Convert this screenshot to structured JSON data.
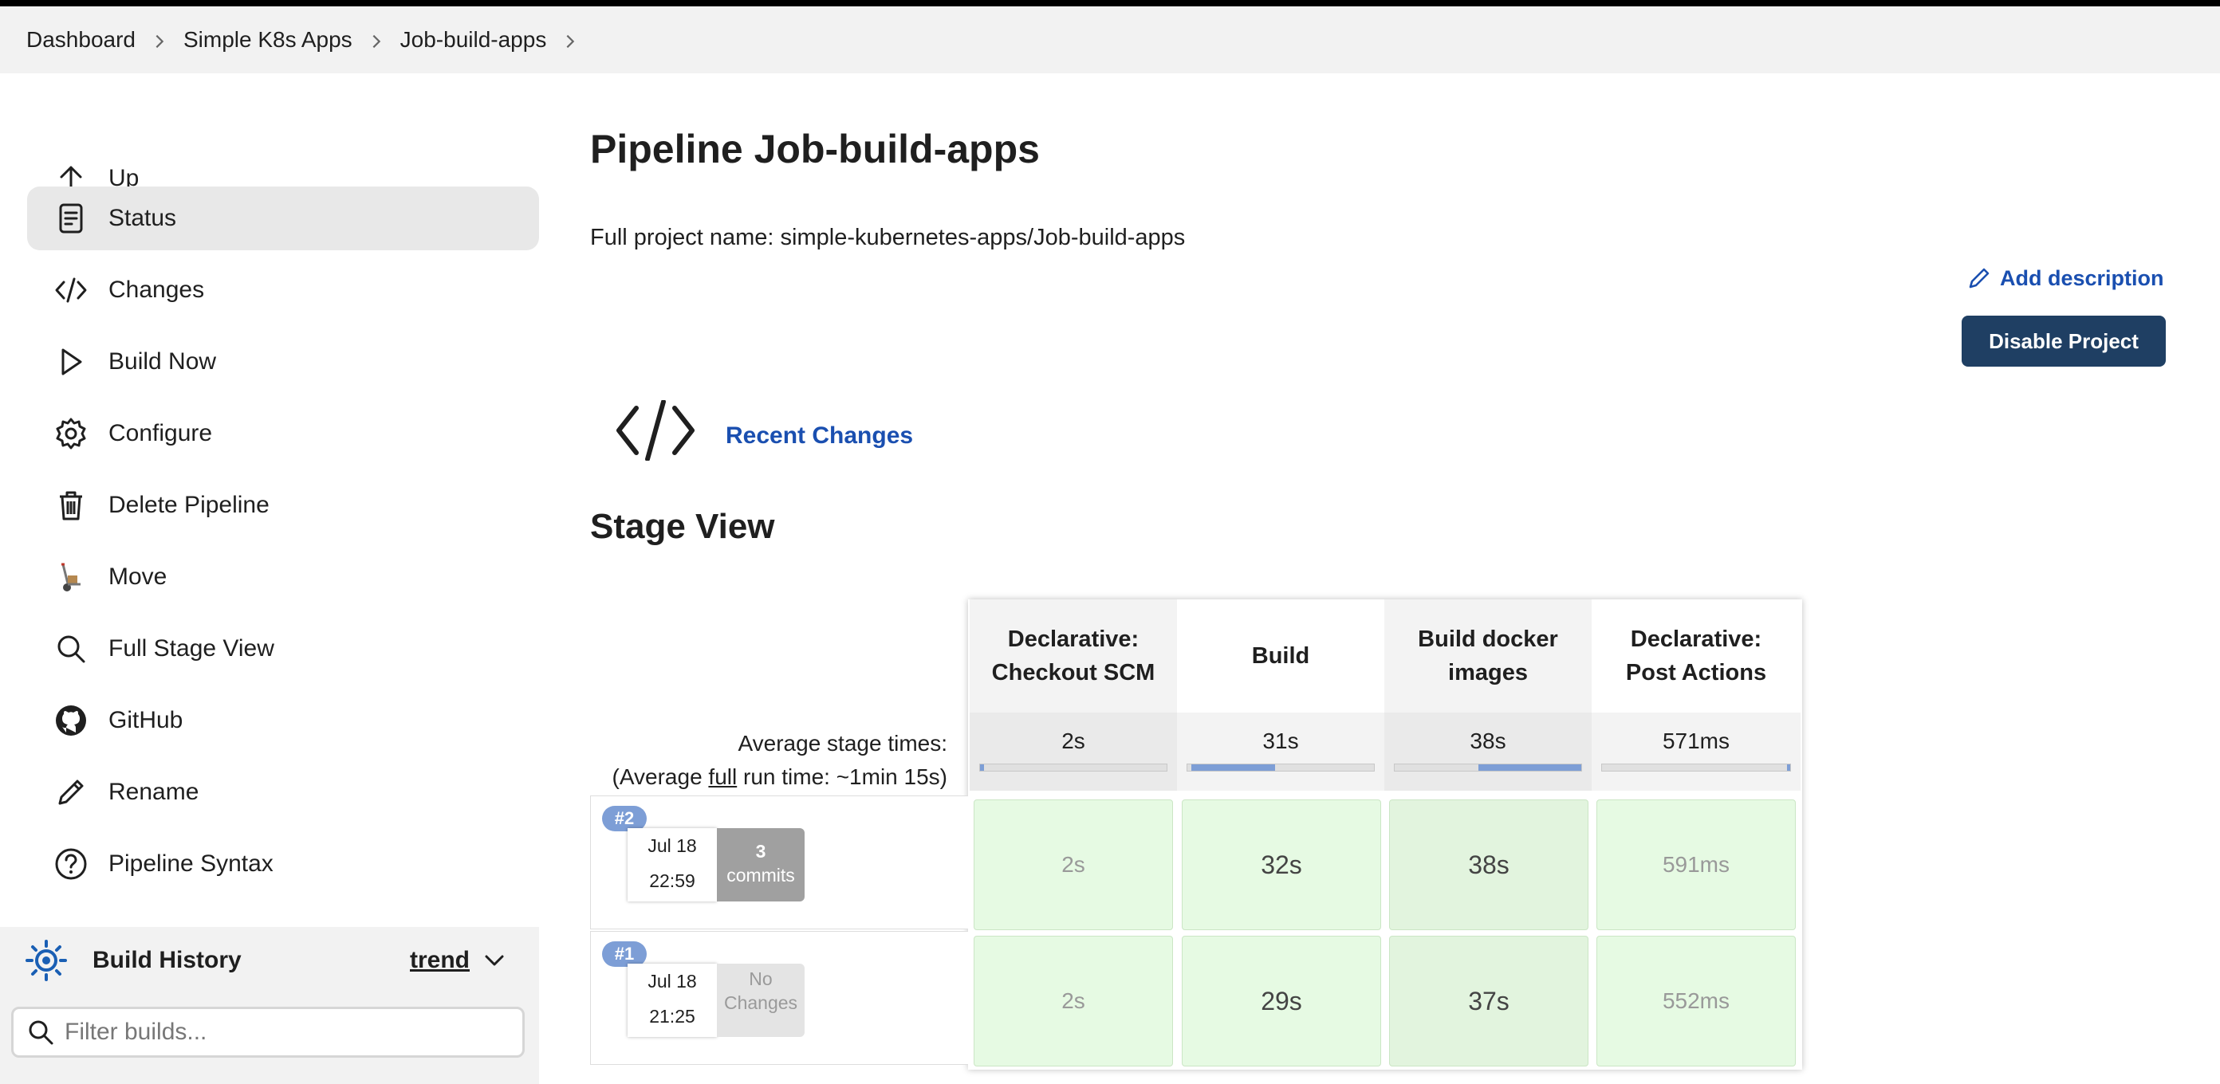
{
  "breadcrumb": [
    "Dashboard",
    "Simple K8s Apps",
    "Job-build-apps"
  ],
  "sidebar": {
    "items": [
      {
        "label": "Up",
        "icon": "arrow-up-icon"
      },
      {
        "label": "Status",
        "icon": "document-icon",
        "active": true
      },
      {
        "label": "Changes",
        "icon": "code-icon"
      },
      {
        "label": "Build Now",
        "icon": "play-icon"
      },
      {
        "label": "Configure",
        "icon": "gear-icon"
      },
      {
        "label": "Delete Pipeline",
        "icon": "trash-icon"
      },
      {
        "label": "Move",
        "icon": "hand-truck-icon"
      },
      {
        "label": "Full Stage View",
        "icon": "search-icon"
      },
      {
        "label": "GitHub",
        "icon": "github-icon"
      },
      {
        "label": "Rename",
        "icon": "pencil-icon"
      },
      {
        "label": "Pipeline Syntax",
        "icon": "help-circle-icon"
      }
    ]
  },
  "build_history": {
    "title": "Build History",
    "trend": "trend",
    "filter_placeholder": "Filter builds..."
  },
  "main": {
    "title": "Pipeline Job-build-apps",
    "full_name": "Full project name: simple-kubernetes-apps/Job-build-apps",
    "add_description": "Add description",
    "disable_button": "Disable Project",
    "recent_changes": "Recent Changes",
    "stage_view_title": "Stage View"
  },
  "stage_view": {
    "avg_label_line1": "Average stage times:",
    "avg_label_pre": "(Average ",
    "avg_label_full": "full",
    "avg_label_post": " run time: ~1min 15s)",
    "stages": [
      {
        "name_line1": "Declarative:",
        "name_line2": "Checkout SCM",
        "avg": "2s",
        "progress": 0.02
      },
      {
        "name_line1": "Build",
        "name_line2": "",
        "avg": "31s",
        "progress": 0.45
      },
      {
        "name_line1": "Build docker",
        "name_line2": "images",
        "avg": "38s",
        "progress": 0.55
      },
      {
        "name_line1": "Declarative:",
        "name_line2": "Post Actions",
        "avg": "571ms",
        "progress": 0.01
      }
    ],
    "runs": [
      {
        "badge": "#2",
        "date": "Jul 18",
        "time": "22:59",
        "changes_line1": "3",
        "changes_line2": "commits",
        "cells": [
          "2s",
          "32s",
          "38s",
          "591ms"
        ]
      },
      {
        "badge": "#1",
        "date": "Jul 18",
        "time": "21:25",
        "changes_line1": "No",
        "changes_line2": "Changes",
        "cells": [
          "2s",
          "29s",
          "37s",
          "552ms"
        ]
      }
    ]
  },
  "colors": {
    "accent": "#1a4fb0",
    "button": "#1f3f63",
    "success_cell": "#e6fae3",
    "progress": "#7d9ed6"
  }
}
